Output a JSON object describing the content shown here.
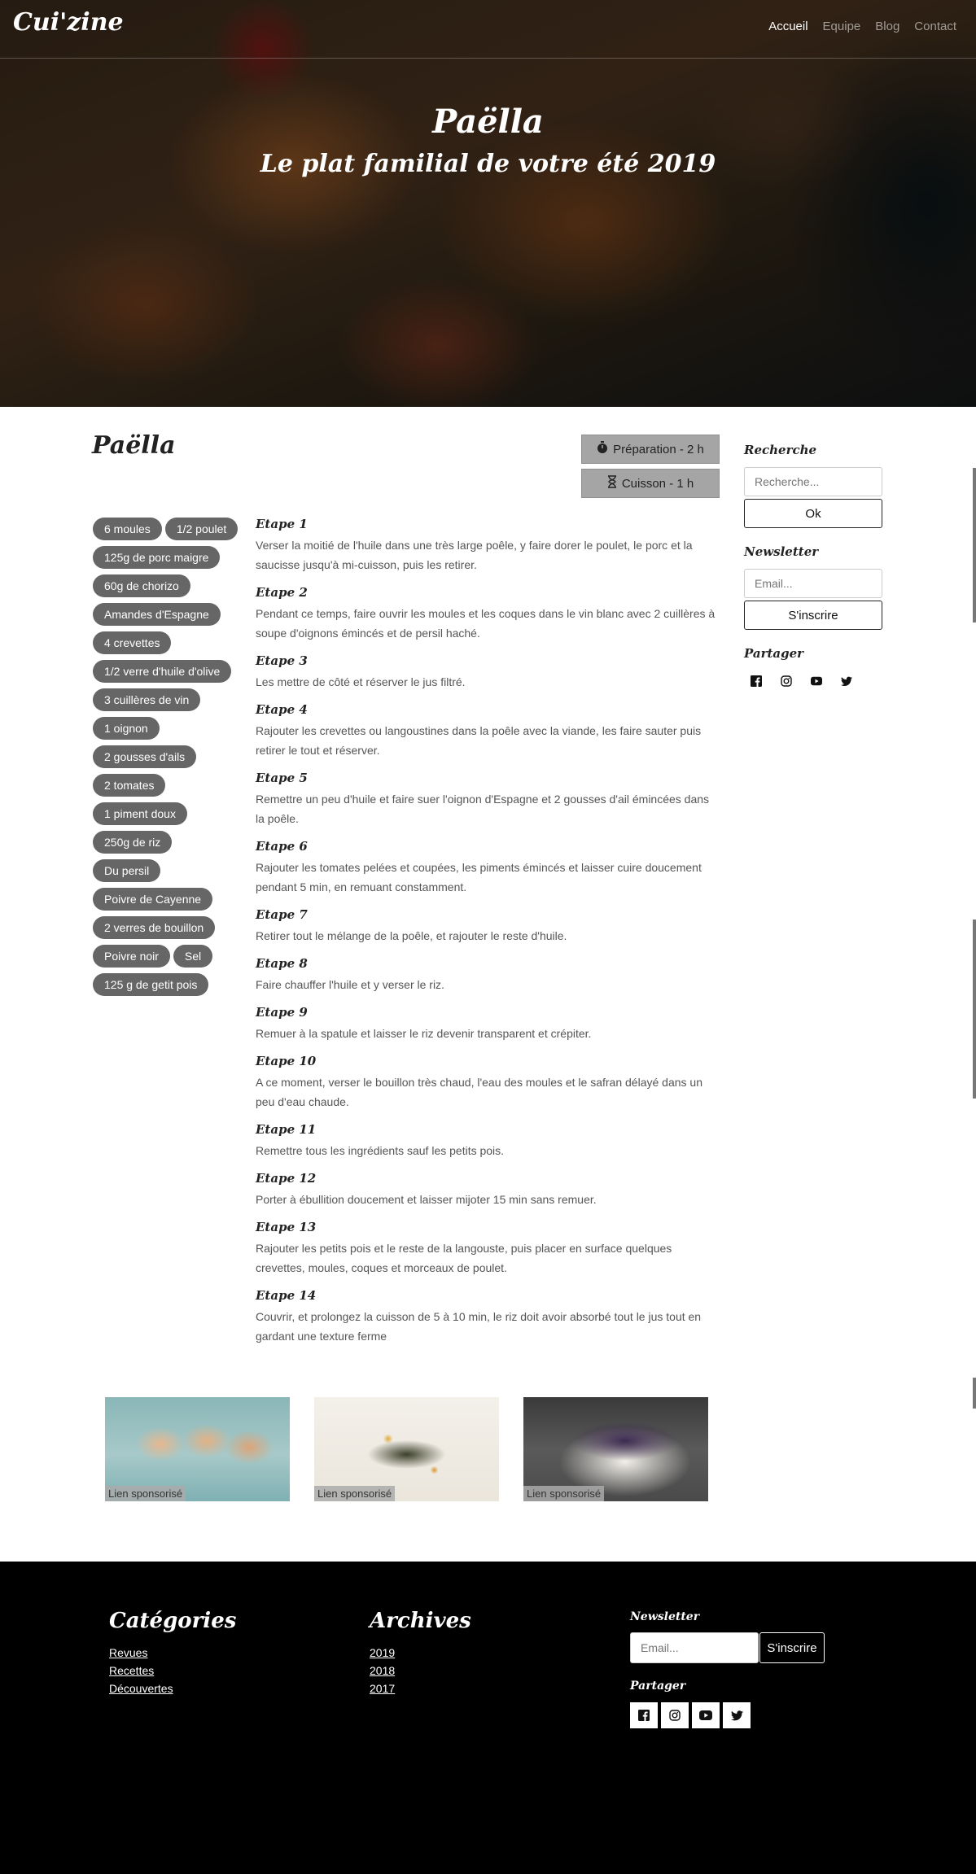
{
  "nav": {
    "brand": "Cui'zine",
    "links": [
      "Accueil",
      "Equipe",
      "Blog",
      "Contact"
    ]
  },
  "hero": {
    "title": "Paëlla",
    "subtitle": "Le plat familial de votre été 2019"
  },
  "recipe": {
    "title": "Paëlla",
    "prep": "Préparation - 2 h",
    "cook": "Cuisson - 1 h",
    "ingredients": [
      "6 moules",
      "1/2 poulet",
      "125g de porc maigre",
      "60g de chorizo",
      "Amandes d'Espagne",
      "4 crevettes",
      "1/2 verre d'huile d'olive",
      "3 cuillères de vin",
      "1 oignon",
      "2 gousses d'ails",
      "2 tomates",
      "1 piment doux",
      "250g de riz",
      "Du persil",
      "Poivre de Cayenne",
      "2 verres de bouillon",
      "Poivre noir",
      "Sel",
      "125 g de getit pois"
    ],
    "steps": [
      {
        "title": "Etape 1",
        "text": "Verser la moitié de l'huile dans une très large poêle, y faire dorer le poulet, le porc et la saucisse jusqu'à mi-cuisson, puis les retirer."
      },
      {
        "title": "Etape 2",
        "text": "Pendant ce temps, faire ouvrir les moules et les coques dans le vin blanc avec 2 cuillères à soupe d'oignons émincés et de persil haché."
      },
      {
        "title": "Etape 3",
        "text": "Les mettre de côté et réserver le jus filtré."
      },
      {
        "title": "Etape 4",
        "text": "Rajouter les crevettes ou langoustines dans la poêle avec la viande, les faire sauter puis retirer le tout et réserver."
      },
      {
        "title": "Etape 5",
        "text": "Remettre un peu d'huile et faire suer l'oignon d'Espagne et 2 gousses d'ail émincées dans la poêle."
      },
      {
        "title": "Etape 6",
        "text": "Rajouter les tomates pelées et coupées, les piments émincés et laisser cuire doucement pendant 5 min, en remuant constamment."
      },
      {
        "title": "Etape 7",
        "text": "Retirer tout le mélange de la poêle, et rajouter le reste d'huile."
      },
      {
        "title": "Etape 8",
        "text": "Faire chauffer l'huile et y verser le riz."
      },
      {
        "title": "Etape 9",
        "text": "Remuer à la spatule et laisser le riz devenir transparent et crépiter."
      },
      {
        "title": "Etape 10",
        "text": "A ce moment, verser le bouillon très chaud, l'eau des moules et le safran délayé dans un peu d'eau chaude."
      },
      {
        "title": "Etape 11",
        "text": "Remettre tous les ingrédients sauf les petits pois."
      },
      {
        "title": "Etape 12",
        "text": "Porter à ébullition doucement et laisser mijoter 15 min sans remuer."
      },
      {
        "title": "Etape 13",
        "text": "Rajouter les petits pois et le reste de la langouste, puis placer en surface quelques crevettes, moules, coques et morceaux de poulet."
      },
      {
        "title": "Etape 14",
        "text": "Couvrir, et prolongez la cuisson de 5 à 10 min, le riz doit avoir absorbé tout le jus tout en gardant une texture ferme"
      }
    ]
  },
  "sidebar": {
    "search_label": "Recherche",
    "search_placeholder": "Recherche...",
    "search_button": "Ok",
    "newsletter_label": "Newsletter",
    "email_placeholder": "Email...",
    "subscribe_button": "S'inscrire",
    "share_label": "Partager",
    "social_icons": [
      "facebook-icon",
      "instagram-icon",
      "youtube-icon",
      "twitter-icon"
    ]
  },
  "sponsors": [
    "Lien sponsorisé",
    "Lien sponsorisé",
    "Lien sponsorisé"
  ],
  "footer": {
    "categories_title": "Catégories",
    "categories": [
      "Revues",
      "Recettes",
      "Découvertes"
    ],
    "archives_title": "Archives",
    "archives": [
      "2019",
      "2018",
      "2017"
    ],
    "newsletter_label": "Newsletter",
    "email_placeholder": "Email...",
    "subscribe_button": "S'inscrire",
    "share_label": "Partager"
  }
}
